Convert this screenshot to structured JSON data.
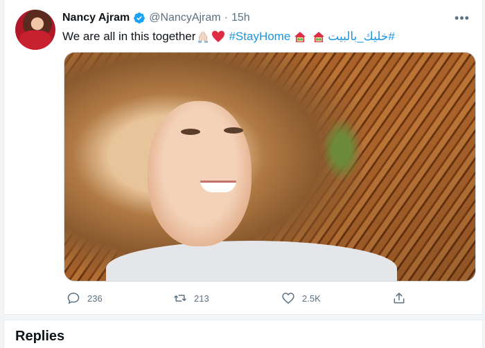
{
  "tweet": {
    "display_name": "Nancy Ajram",
    "handle": "@NancyAjram",
    "separator": "·",
    "time": "15h",
    "text_main": "We are all in this together",
    "hashtag_en": "#StayHome",
    "hashtag_ar": "#خليك_بالبيت",
    "more_label": "•••",
    "replies_count": "236",
    "retweets_count": "213",
    "likes_count": "2.5K"
  },
  "replies_section": {
    "title": "Replies"
  },
  "icons": {
    "verified": "verified-badge-icon",
    "more": "more-options-icon",
    "reply": "reply-icon",
    "retweet": "retweet-icon",
    "like": "heart-icon",
    "share": "share-icon",
    "praying_hands": "praying-hands-emoji",
    "red_heart": "red-heart-emoji",
    "house": "house-with-garden-emoji"
  },
  "colors": {
    "link_blue": "#1b95e0",
    "muted_gray": "#5b7083",
    "heart_red": "#e0245e"
  }
}
